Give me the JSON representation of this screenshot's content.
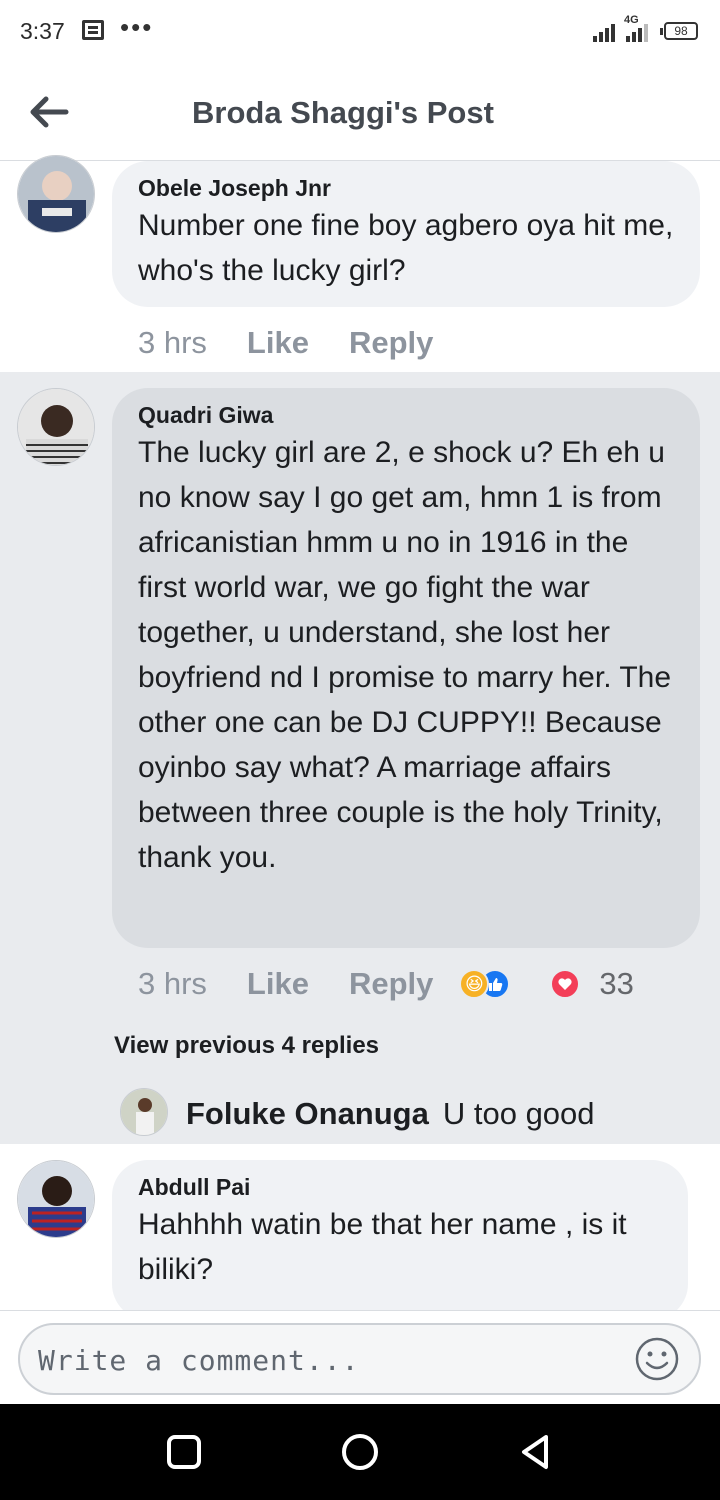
{
  "status_bar": {
    "time": "3:37",
    "network": "4G",
    "battery": "98"
  },
  "header": {
    "title": "Broda Shaggi's Post"
  },
  "comments": [
    {
      "author": "Obele Joseph Jnr",
      "text": "Number one fine boy agbero oya hit me, who's the lucky girl?",
      "time": "3 hrs",
      "like_label": "Like",
      "reply_label": "Reply"
    },
    {
      "author": "Quadri Giwa",
      "text": "The lucky girl are 2, e shock u? Eh eh u no know say I go get am, hmn 1 is from africanistian hmm u no in 1916 in the first world war, we go fight the war together, u understand, she lost her boyfriend nd I promise to marry her. The other one can be DJ CUPPY!! Because oyinbo say what? A marriage affairs between three couple is the holy Trinity, thank you.",
      "time": "3 hrs",
      "like_label": "Like",
      "reply_label": "Reply",
      "reaction_count": "33",
      "reactions": [
        "haha-icon",
        "like-icon",
        "love-icon"
      ],
      "view_previous": "View previous 4 replies",
      "reply_preview": {
        "author": "Foluke Onanuga",
        "text": "U too good"
      }
    },
    {
      "author": "Abdull Pai",
      "text": "Hahhhh watin be that her name , is it biliki?"
    }
  ],
  "composer": {
    "placeholder": "Write a comment..."
  },
  "colors": {
    "highlight_bg": "#e9ebee",
    "bubble_bg": "#f0f2f5",
    "meta_text": "#8d949e",
    "like_blue": "#1877f2",
    "love_red": "#f33e58",
    "haha_yellow": "#f7b125"
  }
}
